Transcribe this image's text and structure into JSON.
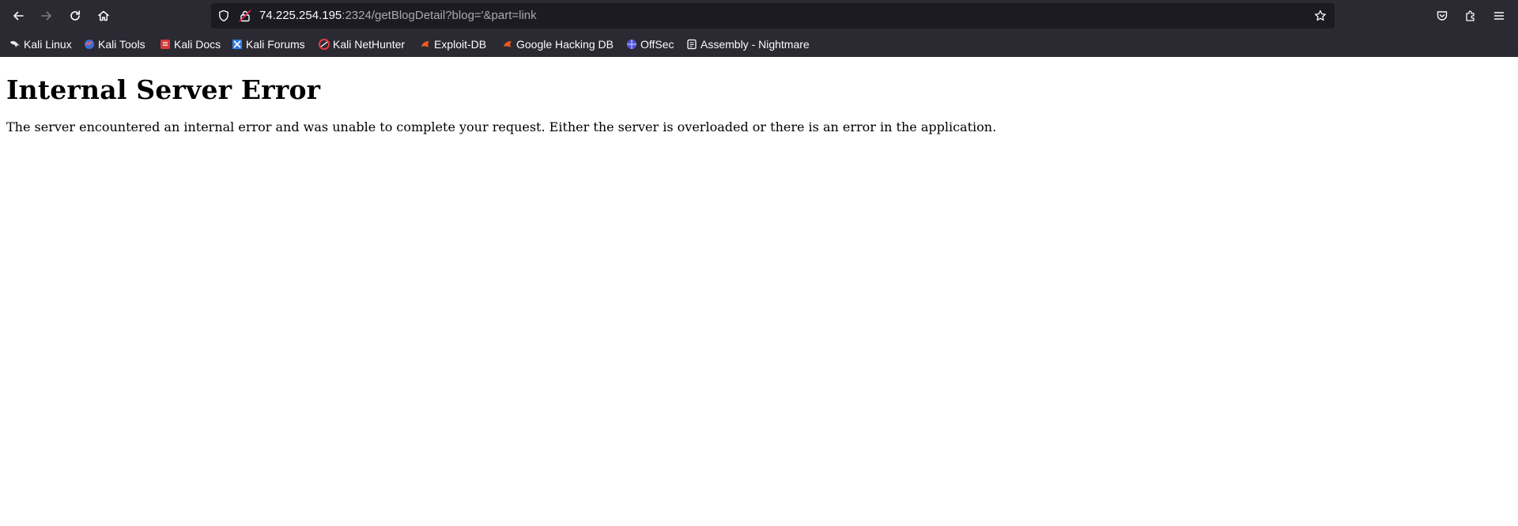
{
  "browser": {
    "url_host": "74.225.254.195",
    "url_rest": ":2324/getBlogDetail?blog='&part=link",
    "bookmarks": [
      {
        "label": "Kali Linux",
        "icon": "kali-dragon-icon"
      },
      {
        "label": "Kali Tools",
        "icon": "kali-tools-icon"
      },
      {
        "label": "Kali Docs",
        "icon": "kali-docs-icon"
      },
      {
        "label": "Kali Forums",
        "icon": "kali-forums-icon"
      },
      {
        "label": "Kali NetHunter",
        "icon": "nethunter-icon"
      },
      {
        "label": "Exploit-DB",
        "icon": "exploit-db-icon"
      },
      {
        "label": "Google Hacking DB",
        "icon": "ghdb-icon"
      },
      {
        "label": "OffSec",
        "icon": "offsec-icon"
      },
      {
        "label": "Assembly - Nightmare",
        "icon": "document-icon"
      }
    ]
  },
  "page": {
    "heading": "Internal Server Error",
    "message": "The server encountered an internal error and was unable to complete your request. Either the server is overloaded or there is an error in the application."
  }
}
